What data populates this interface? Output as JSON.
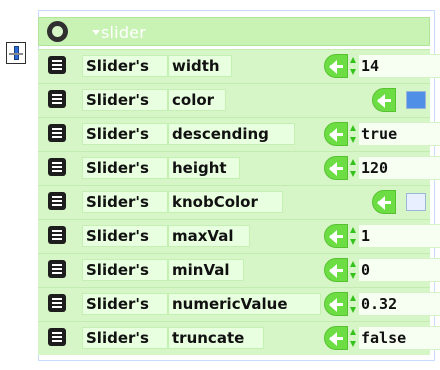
{
  "header": {
    "block_name": "slider"
  },
  "rows": [
    {
      "object": "Slider's",
      "property": "width",
      "value": "14",
      "kind": "number"
    },
    {
      "object": "Slider's",
      "property": "color",
      "value": "",
      "kind": "color",
      "swatch": "#4f8fe8"
    },
    {
      "object": "Slider's",
      "property": "descending",
      "value": "true",
      "kind": "boolean"
    },
    {
      "object": "Slider's",
      "property": "height",
      "value": "120",
      "kind": "number"
    },
    {
      "object": "Slider's",
      "property": "knobColor",
      "value": "",
      "kind": "color",
      "swatch": "#e8f0ff"
    },
    {
      "object": "Slider's",
      "property": "maxVal",
      "value": "1",
      "kind": "number"
    },
    {
      "object": "Slider's",
      "property": "minVal",
      "value": "0",
      "kind": "number"
    },
    {
      "object": "Slider's",
      "property": "numericValue",
      "value": "0.32",
      "kind": "number"
    },
    {
      "object": "Slider's",
      "property": "truncate",
      "value": "false",
      "kind": "boolean"
    }
  ],
  "colors": {
    "block_bg": "#d7f6c7",
    "header_bg": "#c8f3b4",
    "accent_green": "#6cde43",
    "stepper_green": "#36c21d",
    "handle_blue": "#2a6bd6",
    "frame_border": "#c7dcff"
  },
  "icons": {
    "header_gear": "gear-icon",
    "row_doc": "doc-icon",
    "setter_arrow": "left-arrow-icon",
    "stepper": "updown-stepper-icon",
    "collapse": "collapse-handle-icon"
  }
}
